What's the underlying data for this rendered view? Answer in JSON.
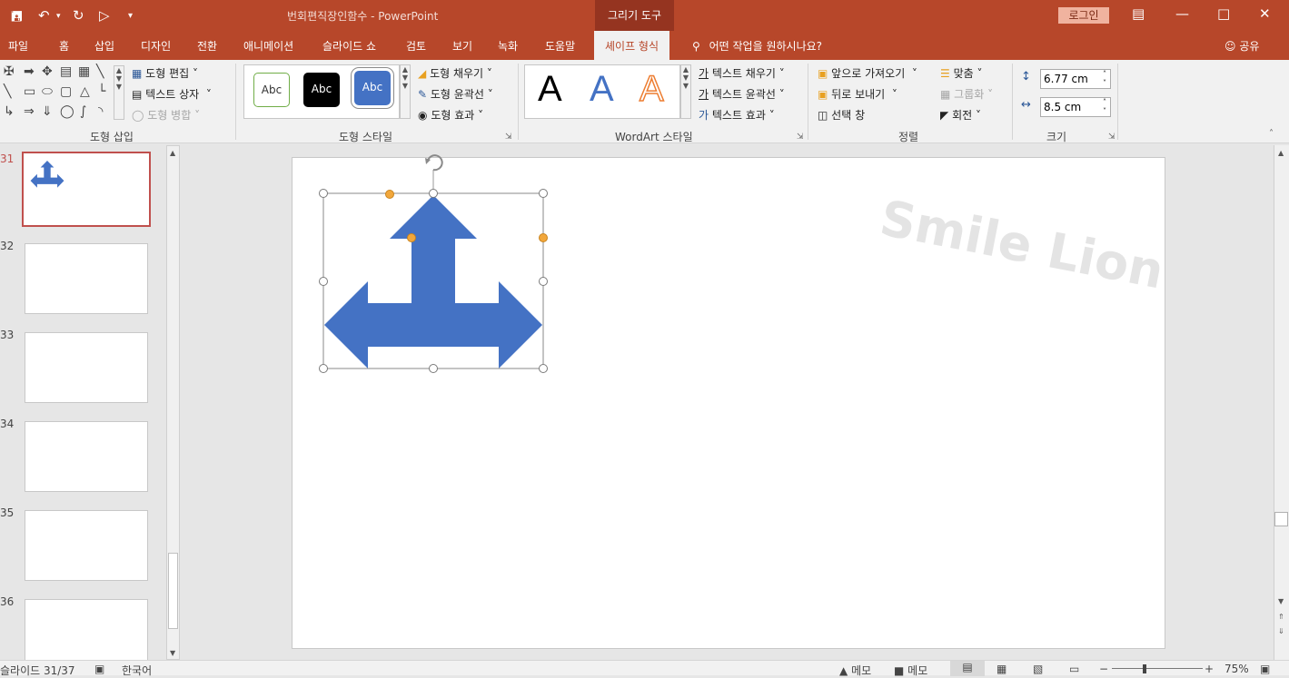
{
  "titlebar": {
    "document_title": "번회편직장인함수  -  PowerPoint",
    "context_tab": "그리기 도구",
    "login_label": "로그인",
    "qat_icons": [
      "save-icon",
      "undo-icon",
      "redo-icon",
      "present-icon",
      "customize-icon"
    ],
    "window_buttons": [
      "ribbon-display-icon",
      "minimize-icon",
      "maximize-icon",
      "close-icon"
    ]
  },
  "tabs": [
    "파일",
    "홈",
    "삽입",
    "디자인",
    "전환",
    "애니메이션",
    "슬라이드 쇼",
    "검토",
    "보기",
    "녹화",
    "도움말",
    "셰이프 형식"
  ],
  "active_tab": "셰이프 형식",
  "tellme": "어떤 작업을 원하시나요?",
  "share": "공유",
  "ribbon": {
    "insert_shapes": {
      "label": "도형 삽입",
      "edit_shape": "도형 편집",
      "text_box": "텍스트 상자",
      "merge_shapes": "도형 병합"
    },
    "shape_styles": {
      "label": "도형 스타일",
      "samples": [
        "Abc",
        "Abc",
        "Abc"
      ],
      "fill": "도형 채우기",
      "outline": "도형 윤곽선",
      "effects": "도형 효과"
    },
    "wordart_styles": {
      "label": "WordArt 스타일",
      "samples": [
        "A",
        "A",
        "A"
      ],
      "text_fill": "텍스트 채우기",
      "text_outline": "텍스트 윤곽선",
      "text_effects": "텍스트 효과"
    },
    "arrange": {
      "label": "정렬",
      "bring_forward": "앞으로 가져오기",
      "send_backward": "뒤로 보내기",
      "selection_pane": "선택 창",
      "align": "맞춤",
      "group": "그룹화",
      "rotate": "회전"
    },
    "size": {
      "label": "크기",
      "height": "6.77 cm",
      "width": "8.5 cm"
    }
  },
  "thumbnails": [
    {
      "num": "31",
      "selected": true
    },
    {
      "num": "32",
      "selected": false
    },
    {
      "num": "33",
      "selected": false
    },
    {
      "num": "34",
      "selected": false
    },
    {
      "num": "35",
      "selected": false
    },
    {
      "num": "36",
      "selected": false
    }
  ],
  "slide": {
    "watermark": "Smile Lion",
    "shape_color": "#4472c4"
  },
  "statusbar": {
    "slide_info": "슬라이드 31/37",
    "language": "한국어",
    "notes": "메모",
    "comments": "메모",
    "zoom": "75%"
  },
  "colors": {
    "accent": "#b7472a",
    "selection": "#c0504d"
  }
}
